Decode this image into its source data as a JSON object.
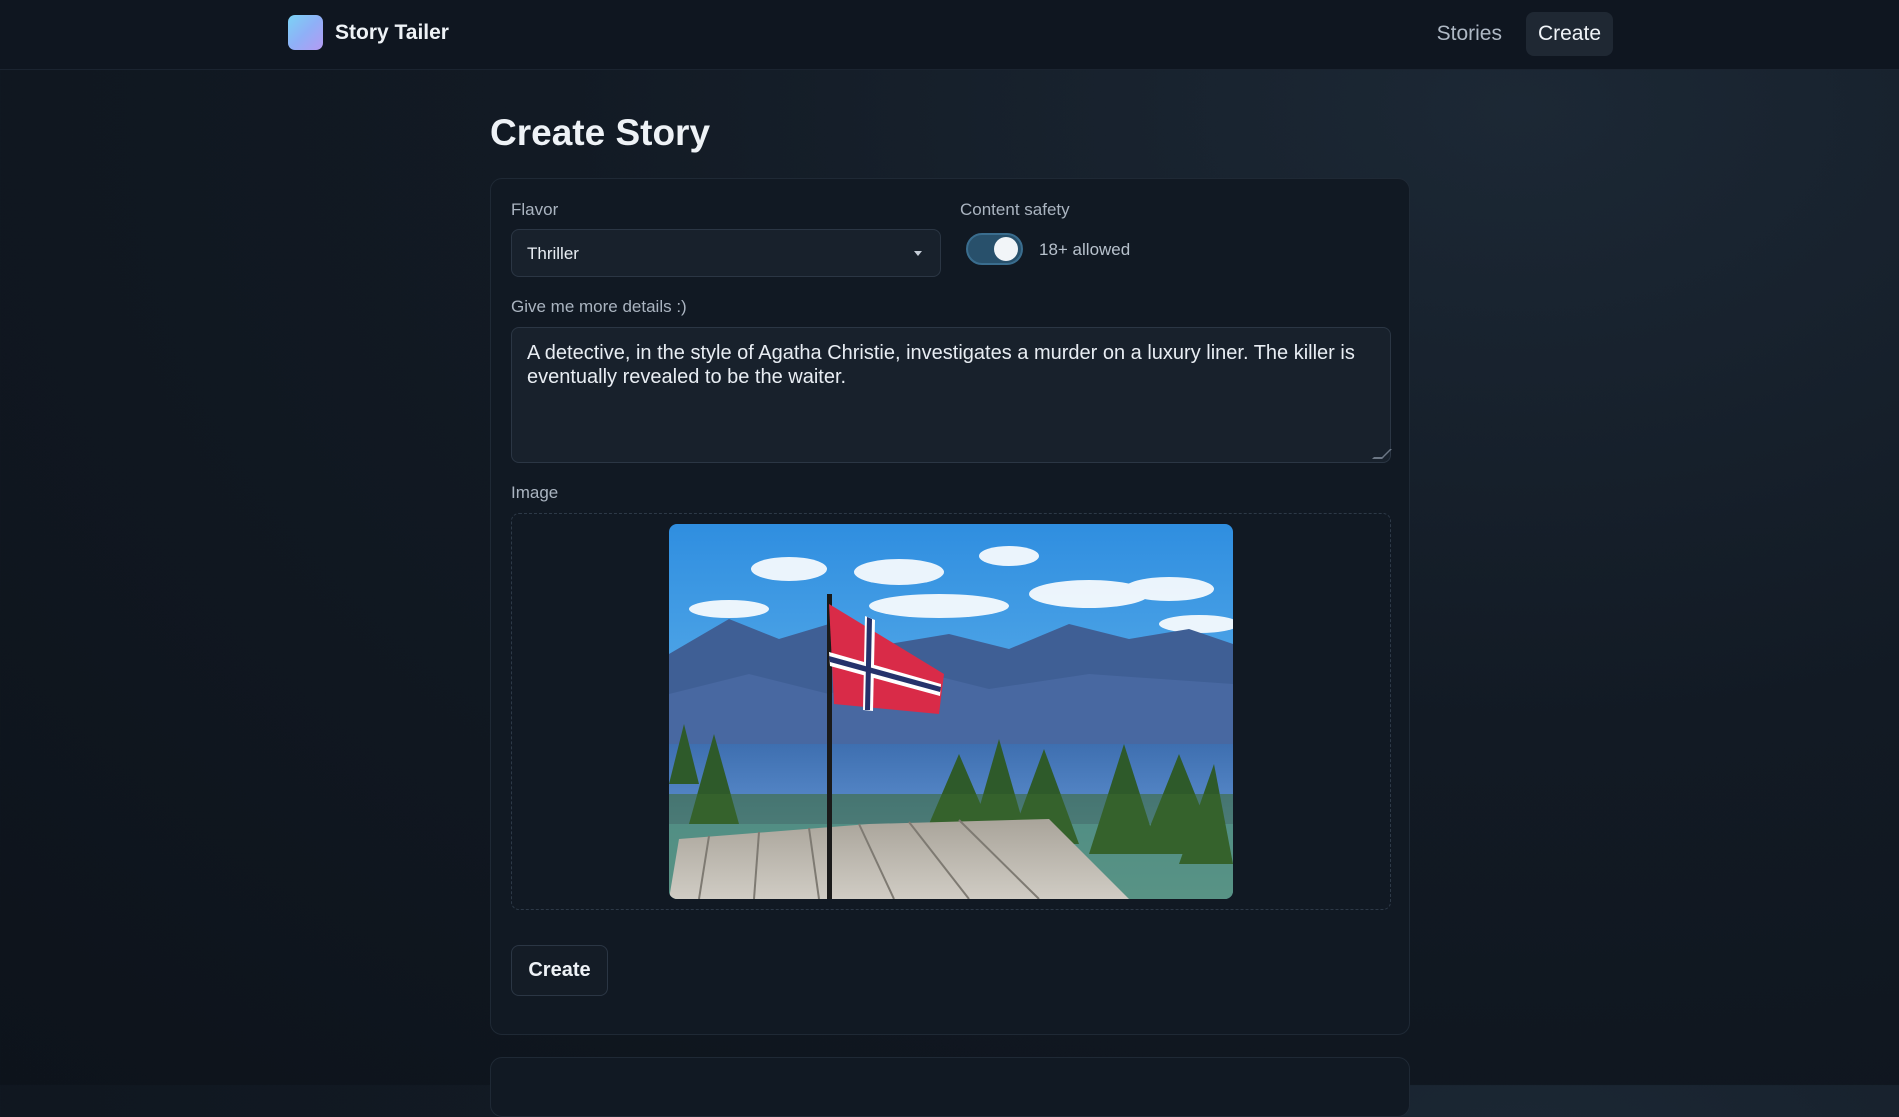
{
  "app": {
    "name": "Story Tailer"
  },
  "nav": [
    {
      "label": "Stories",
      "active": false
    },
    {
      "label": "Create",
      "active": true
    }
  ],
  "page": {
    "title": "Create Story"
  },
  "form": {
    "flavor": {
      "label": "Flavor",
      "value": "Thriller"
    },
    "content_safety": {
      "label": "Content safety",
      "enabled": true,
      "toggle_text": "18+ allowed"
    },
    "details": {
      "label": "Give me more details :)",
      "value": "A detective, in the style of Agatha Christie, investigates a murder on a luxury liner. The killer is eventually revealed to be the waiter."
    },
    "image": {
      "label": "Image",
      "icon": "uploaded-photo-norwegian-flag"
    },
    "submit_label": "Create"
  },
  "colors": {
    "background": "#121a24",
    "card": "#111923",
    "toggle_on": "#28506b",
    "flag_red": "#d92b48",
    "flag_cross": "#25326b"
  }
}
